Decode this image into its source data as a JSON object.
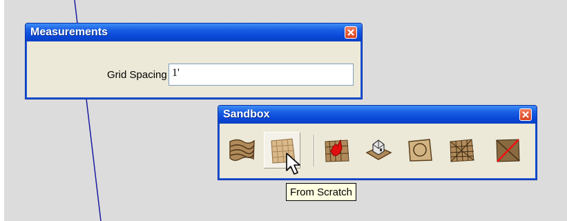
{
  "measurements": {
    "title": "Measurements",
    "grid_label": "Grid Spacing",
    "grid_value": "1'"
  },
  "sandbox": {
    "title": "Sandbox",
    "tools": [
      {
        "name": "from-contours",
        "icon": "terrain-contours-icon"
      },
      {
        "name": "from-scratch",
        "icon": "terrain-grid-icon",
        "active": true
      },
      {
        "name": "smoove",
        "icon": "smoove-icon"
      },
      {
        "name": "stamp",
        "icon": "stamp-icon"
      },
      {
        "name": "drape",
        "icon": "drape-icon"
      },
      {
        "name": "add-detail",
        "icon": "add-detail-icon"
      },
      {
        "name": "flip-edge",
        "icon": "flip-edge-icon"
      }
    ]
  },
  "tooltip": "From Scratch",
  "colors": {
    "titlebar": "#0a49d8",
    "window_bg": "#ece9d8",
    "viewport_bg": "#dcdcdc",
    "close_button": "#d9421f",
    "axis_line": "#1a1aa0",
    "tooltip_bg": "#ffffe1"
  }
}
